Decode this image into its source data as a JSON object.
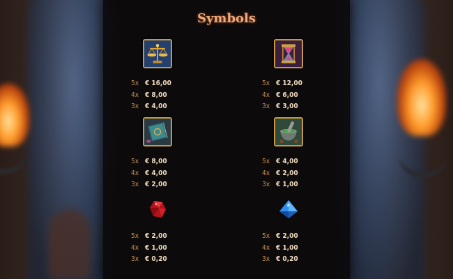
{
  "title": "Symbols",
  "colors": {
    "title": "#f0a97a",
    "multiplier": "#c8924e",
    "amount": "#f2ddc0",
    "frame": "#c89a3c",
    "panel": "#0c0a0b"
  },
  "symbols": [
    {
      "icon": "scales-icon",
      "pays": [
        {
          "mult": "5x",
          "amount": "€ 16,00"
        },
        {
          "mult": "4x",
          "amount": "€ 8,00"
        },
        {
          "mult": "3x",
          "amount": "€ 4,00"
        }
      ]
    },
    {
      "icon": "hourglass-icon",
      "pays": [
        {
          "mult": "5x",
          "amount": "€ 12,00"
        },
        {
          "mult": "4x",
          "amount": "€ 6,00"
        },
        {
          "mult": "3x",
          "amount": "€ 3,00"
        }
      ]
    },
    {
      "icon": "spellbook-icon",
      "pays": [
        {
          "mult": "5x",
          "amount": "€ 8,00"
        },
        {
          "mult": "4x",
          "amount": "€ 4,00"
        },
        {
          "mult": "3x",
          "amount": "€ 2,00"
        }
      ]
    },
    {
      "icon": "mortar-pestle-icon",
      "pays": [
        {
          "mult": "5x",
          "amount": "€ 4,00"
        },
        {
          "mult": "4x",
          "amount": "€ 2,00"
        },
        {
          "mult": "3x",
          "amount": "€ 1,00"
        }
      ]
    },
    {
      "icon": "red-gem-icon",
      "pays": [
        {
          "mult": "5x",
          "amount": "€ 2,00"
        },
        {
          "mult": "4x",
          "amount": "€ 1,00"
        },
        {
          "mult": "3x",
          "amount": "€ 0,20"
        }
      ]
    },
    {
      "icon": "blue-gem-icon",
      "pays": [
        {
          "mult": "5x",
          "amount": "€ 2,00"
        },
        {
          "mult": "4x",
          "amount": "€ 1,00"
        },
        {
          "mult": "3x",
          "amount": "€ 0,20"
        }
      ]
    }
  ]
}
